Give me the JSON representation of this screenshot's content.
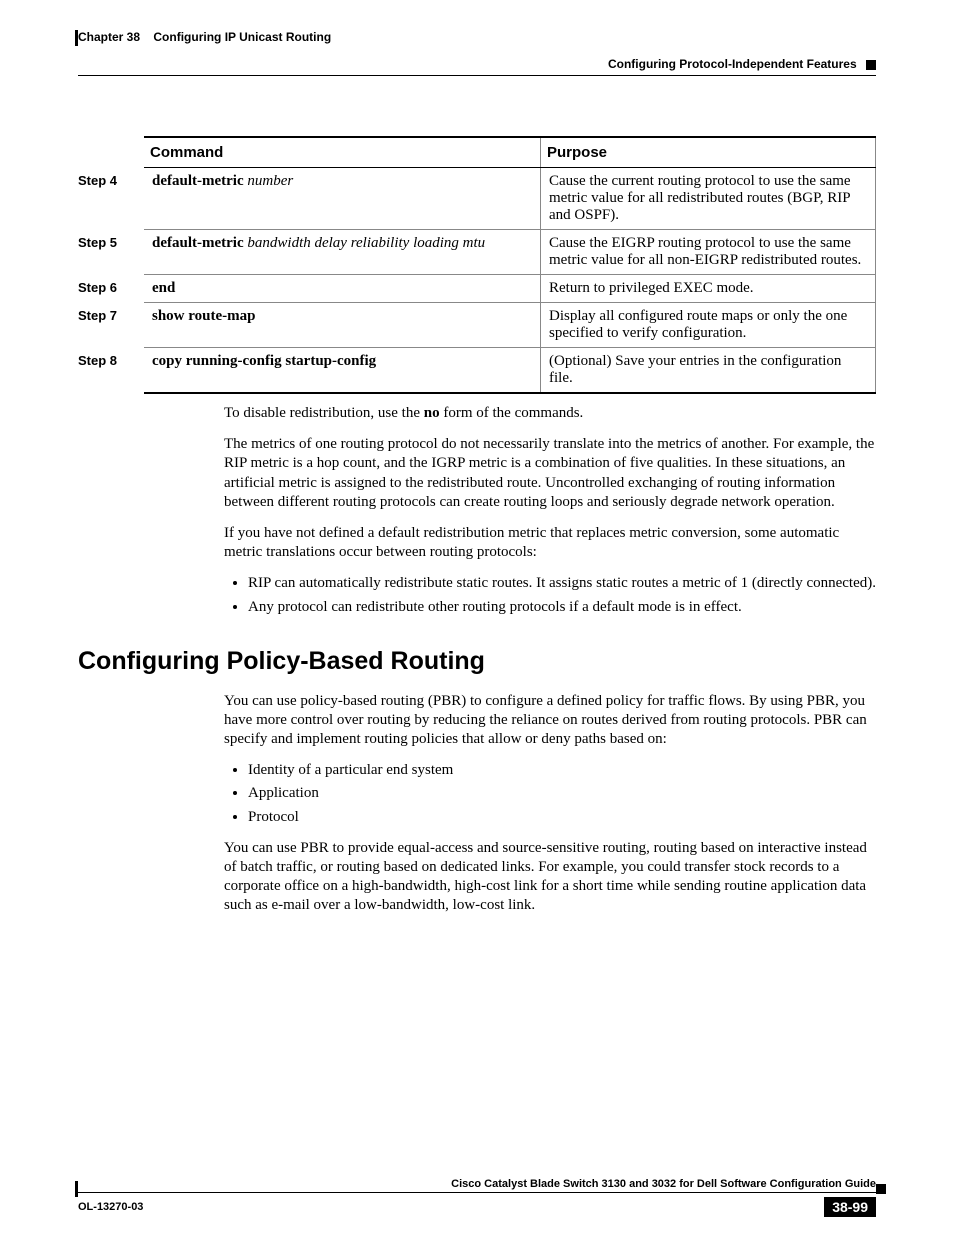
{
  "header": {
    "chapter": "Chapter 38",
    "title": "Configuring IP Unicast Routing",
    "section": "Configuring Protocol-Independent Features"
  },
  "table": {
    "headers": {
      "command": "Command",
      "purpose": "Purpose"
    },
    "rows": [
      {
        "step": "Step 4",
        "cmd_bold": "default-metric",
        "cmd_italic": "number",
        "purpose": "Cause the current routing protocol to use the same metric value for all redistributed routes (BGP, RIP and OSPF)."
      },
      {
        "step": "Step 5",
        "cmd_bold": "default-metric",
        "cmd_italic": "bandwidth delay reliability loading mtu",
        "purpose": "Cause the EIGRP routing protocol to use the same metric value for all non-EIGRP redistributed routes."
      },
      {
        "step": "Step 6",
        "cmd_bold": "end",
        "cmd_italic": "",
        "purpose": "Return to privileged EXEC mode."
      },
      {
        "step": "Step 7",
        "cmd_bold": "show route-map",
        "cmd_italic": "",
        "purpose": "Display all configured route maps or only the one specified to verify configuration."
      },
      {
        "step": "Step 8",
        "cmd_bold": "copy running-config startup-config",
        "cmd_italic": "",
        "purpose": "(Optional) Save your entries in the configuration file."
      }
    ]
  },
  "body": {
    "p1_before": "To disable redistribution, use the ",
    "p1_bold": "no",
    "p1_after": " form of the commands.",
    "p2": "The metrics of one routing protocol do not necessarily translate into the metrics of another. For example, the RIP metric is a hop count, and the IGRP metric is a combination of five qualities. In these situations, an artificial metric is assigned to the redistributed route. Uncontrolled exchanging of routing information between different routing protocols can create routing loops and seriously degrade network operation.",
    "p3": "If you have not defined a default redistribution metric that replaces metric conversion, some automatic metric translations occur between routing protocols:",
    "bullets1": [
      "RIP can automatically redistribute static routes. It assigns static routes a metric of 1 (directly connected).",
      "Any protocol can redistribute other routing protocols if a default mode is in effect."
    ]
  },
  "section_heading": "Configuring Policy-Based Routing",
  "body2": {
    "p1": "You can use policy-based routing (PBR) to configure a defined policy for traffic flows. By using PBR, you have more control over routing by reducing the reliance on routes derived from routing protocols. PBR can specify and implement routing policies that allow or deny paths based on:",
    "bullets": [
      "Identity of a particular end system",
      "Application",
      "Protocol"
    ],
    "p2": "You can use PBR to provide equal-access and source-sensitive routing, routing based on interactive instead of batch traffic, or routing based on dedicated links. For example, you could transfer stock records to a corporate office on a high-bandwidth, high-cost link for a short time while sending routine application data such as e-mail over a low-bandwidth, low-cost link."
  },
  "footer": {
    "guide": "Cisco Catalyst Blade Switch 3130 and 3032 for Dell Software Configuration Guide",
    "doc": "OL-13270-03",
    "page": "38-99"
  }
}
